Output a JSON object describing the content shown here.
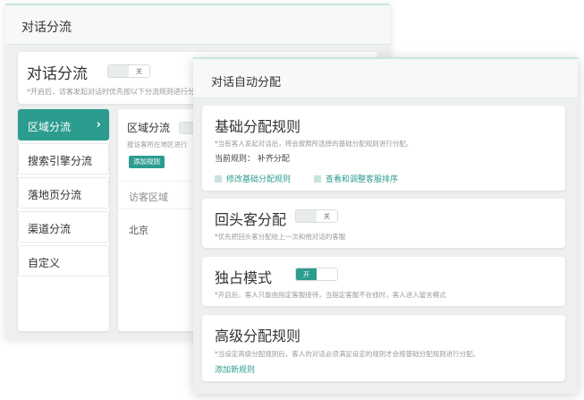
{
  "back_window": {
    "title": "对话分流",
    "header_card": {
      "heading": "对话分流",
      "toggle_label": "关",
      "hint": "*开启后，访客发起对话时优先按以下分流规则进行分配"
    },
    "sidebar": {
      "items": [
        {
          "label": "区域分流"
        },
        {
          "label": "搜索引擎分流"
        },
        {
          "label": "落地页分流"
        },
        {
          "label": "渠道分流"
        },
        {
          "label": "自定义"
        }
      ]
    },
    "main": {
      "title": "区域分流",
      "hint": "按访客所在地区进行",
      "add_button": "添加规则",
      "column_header": "访客区域",
      "rows": [
        "北京"
      ]
    }
  },
  "front_window": {
    "title": "对话自动分配",
    "basic_rules": {
      "title": "基础分配规则",
      "hint": "*当有客人发起对话后，将会按照所选择的基础分配规则进行分配。",
      "current_rule": "当前规则： 补齐分配",
      "modify_link": "修改基础分配规则",
      "view_link": "查看和调整客服排序"
    },
    "returning": {
      "title": "回头客分配",
      "toggle_label": "关",
      "hint": "*优先把回头客分配给上一次和他对话的客服"
    },
    "exclusive": {
      "title": "独占模式",
      "toggle_label": "开",
      "hint": "*开启后，客人只能由指定客服接待，当指定客服不在线时，客人进入留言模式"
    },
    "advanced": {
      "title": "高级分配规则",
      "hint": "*当设定高级分配规则后，客人的对话必须满足设定的规则才会按基础分配规则进行分配。",
      "add_link": "添加新规则"
    }
  },
  "colors": {
    "accent": "#2c9c8f",
    "accent_light": "#c8e3e0",
    "panel_bg": "#eef0f0"
  }
}
